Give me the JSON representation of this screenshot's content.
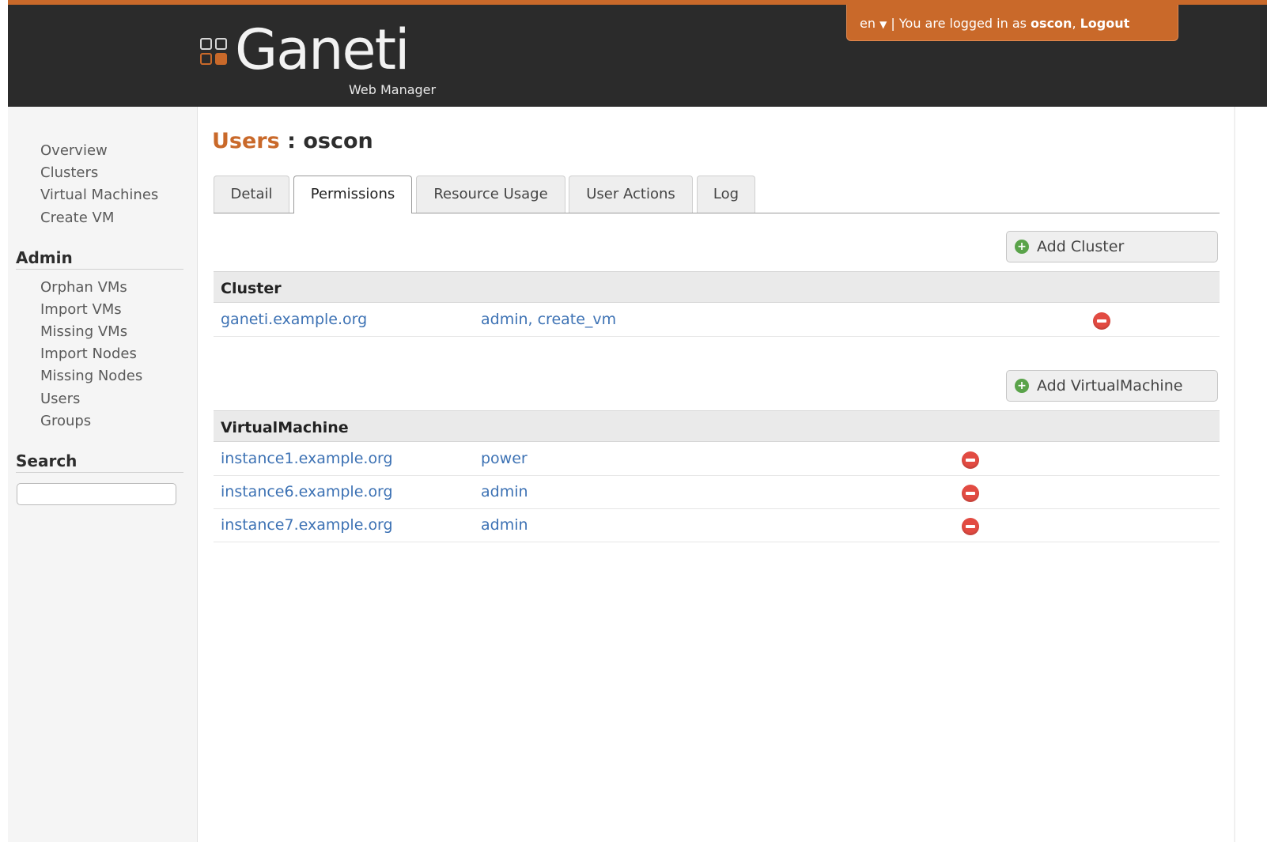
{
  "header": {
    "logo_name": "Ganeti",
    "logo_subtitle": "Web Manager",
    "language": "en",
    "language_arrow": "▼",
    "logged_in_text": "| You are logged in as",
    "username": "oscon",
    "logout_label": "Logout"
  },
  "sidebar": {
    "nav": [
      "Overview",
      "Clusters",
      "Virtual Machines",
      "Create VM"
    ],
    "admin_heading": "Admin",
    "admin_items": [
      "Orphan VMs",
      "Import VMs",
      "Missing VMs",
      "Import Nodes",
      "Missing Nodes",
      "Users",
      "Groups"
    ],
    "search_heading": "Search",
    "search_value": ""
  },
  "main": {
    "title_section": "Users",
    "title_separator": ":",
    "title_name": "oscon",
    "tabs": [
      "Detail",
      "Permissions",
      "Resource Usage",
      "User Actions",
      "Log"
    ],
    "active_tab": "Permissions",
    "cluster_section": {
      "add_label": "Add Cluster",
      "header": "Cluster",
      "rows": [
        {
          "name": "ganeti.example.org",
          "permissions": "admin, create_vm"
        }
      ]
    },
    "vm_section": {
      "add_label": "Add VirtualMachine",
      "header": "VirtualMachine",
      "rows": [
        {
          "name": "instance1.example.org",
          "permissions": "power"
        },
        {
          "name": "instance6.example.org",
          "permissions": "admin"
        },
        {
          "name": "instance7.example.org",
          "permissions": "admin"
        }
      ]
    }
  },
  "colors": {
    "accent": "#c9692a",
    "header_bg": "#2b2b2b",
    "link": "#3d72b4",
    "remove": "#e24b42",
    "add": "#5aa34a"
  },
  "icons": {
    "add": "plus-circle-icon",
    "remove": "minus-circle-icon"
  }
}
